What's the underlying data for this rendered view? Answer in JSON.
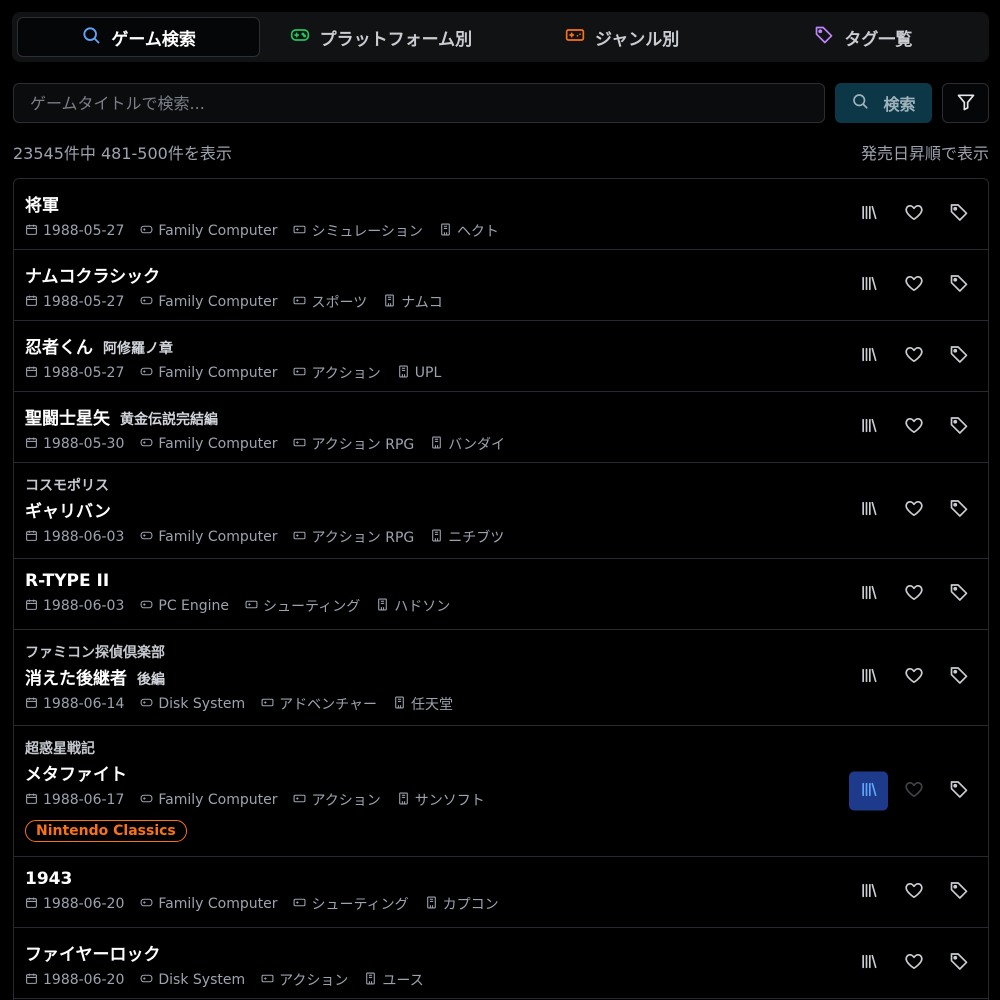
{
  "tabs": [
    {
      "label": "ゲーム検索",
      "icon": "search-icon",
      "color": "#60a5fa",
      "active": true
    },
    {
      "label": "プラットフォーム別",
      "icon": "gamepad-icon",
      "color": "#22c55e",
      "active": false
    },
    {
      "label": "ジャンル別",
      "icon": "controller-icon",
      "color": "#f97316",
      "active": false
    },
    {
      "label": "タグ一覧",
      "icon": "tag-icon",
      "color": "#c084fc",
      "active": false
    }
  ],
  "search": {
    "placeholder": "ゲームタイトルで検索...",
    "value": "",
    "button_label": "検索"
  },
  "summary": {
    "count_text": "23545件中 481-500件を表示",
    "sort_text": "発売日昇順で表示"
  },
  "items": [
    {
      "pre": "",
      "title": "将軍",
      "sub": "",
      "date": "1988-05-27",
      "platform": "Family Computer",
      "genre": "シミュレーション",
      "publisher": "ヘクト",
      "badge": "",
      "collected": false
    },
    {
      "pre": "",
      "title": "ナムコクラシック",
      "sub": "",
      "date": "1988-05-27",
      "platform": "Family Computer",
      "genre": "スポーツ",
      "publisher": "ナムコ",
      "badge": "",
      "collected": false
    },
    {
      "pre": "",
      "title": "忍者くん",
      "sub": "阿修羅ノ章",
      "date": "1988-05-27",
      "platform": "Family Computer",
      "genre": "アクション",
      "publisher": "UPL",
      "badge": "",
      "collected": false
    },
    {
      "pre": "",
      "title": "聖闘士星矢",
      "sub": "黄金伝説完結編",
      "date": "1988-05-30",
      "platform": "Family Computer",
      "genre": "アクション RPG",
      "publisher": "バンダイ",
      "badge": "",
      "collected": false
    },
    {
      "pre": "コスモポリス",
      "title": "ギャリバン",
      "sub": "",
      "date": "1988-06-03",
      "platform": "Family Computer",
      "genre": "アクション RPG",
      "publisher": "ニチブツ",
      "badge": "",
      "collected": false
    },
    {
      "pre": "",
      "title": "R-TYPE II",
      "sub": "",
      "date": "1988-06-03",
      "platform": "PC Engine",
      "genre": "シューティング",
      "publisher": "ハドソン",
      "badge": "",
      "collected": false
    },
    {
      "pre": "ファミコン探偵倶楽部",
      "title": "消えた後継者",
      "sub": "後編",
      "date": "1988-06-14",
      "platform": "Disk System",
      "genre": "アドベンチャー",
      "publisher": "任天堂",
      "badge": "",
      "collected": false
    },
    {
      "pre": "超惑星戦記",
      "title": "メタファイト",
      "sub": "",
      "date": "1988-06-17",
      "platform": "Family Computer",
      "genre": "アクション",
      "publisher": "サンソフト",
      "badge": "Nintendo Classics",
      "collected": true
    },
    {
      "pre": "",
      "title": "1943",
      "sub": "",
      "date": "1988-06-20",
      "platform": "Family Computer",
      "genre": "シューティング",
      "publisher": "カプコン",
      "badge": "",
      "collected": false
    },
    {
      "pre": "",
      "title": "ファイヤーロック",
      "sub": "",
      "date": "1988-06-20",
      "platform": "Disk System",
      "genre": "アクション",
      "publisher": "ユース",
      "badge": "",
      "collected": false
    }
  ],
  "colors": {
    "accent": "#60a5fa",
    "badge": "#f97316",
    "collected_bg": "#1e3a8a"
  }
}
